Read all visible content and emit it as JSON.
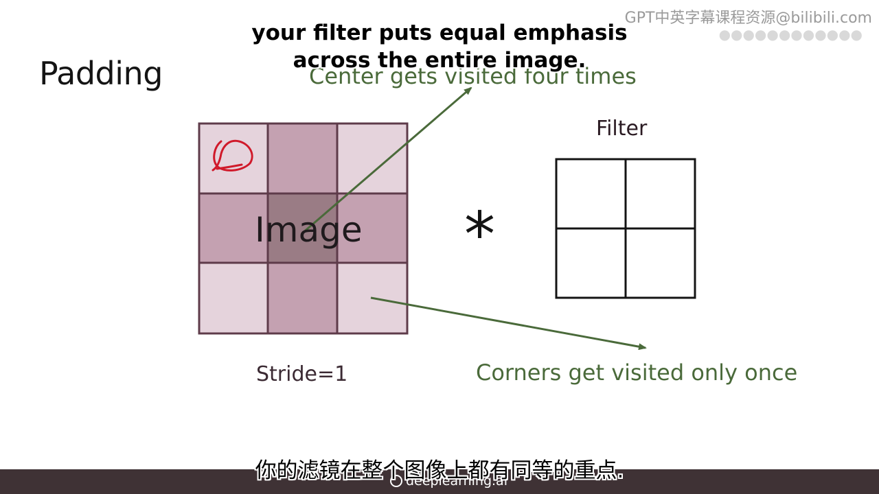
{
  "slide": {
    "title": "Padding",
    "image_label": "Image",
    "filter_label": "Filter",
    "operator": "*",
    "stride_label": "Stride=1",
    "annotation_center": "Center gets visited four times",
    "annotation_corners": "Corners get visited only once"
  },
  "subtitles": {
    "english_line1": "your filter puts equal emphasis",
    "english_line2": "across the entire image.",
    "chinese": "你的滤镜在整个图像上都有同等的重点."
  },
  "overlay": {
    "watermark": "GPT中英字幕课程资源@bilibili.com"
  },
  "footer": {
    "brand": "deeplearning.ai"
  },
  "colors": {
    "grid_border": "#5e3b4a",
    "corner_cell": "#e5d3dc",
    "edge_cell": "#c4a1b1",
    "center_cell": "#9a7c85",
    "annotation_green": "#4a6a3a",
    "ink_red": "#d0192a",
    "footer_bar": "#3f3235"
  }
}
